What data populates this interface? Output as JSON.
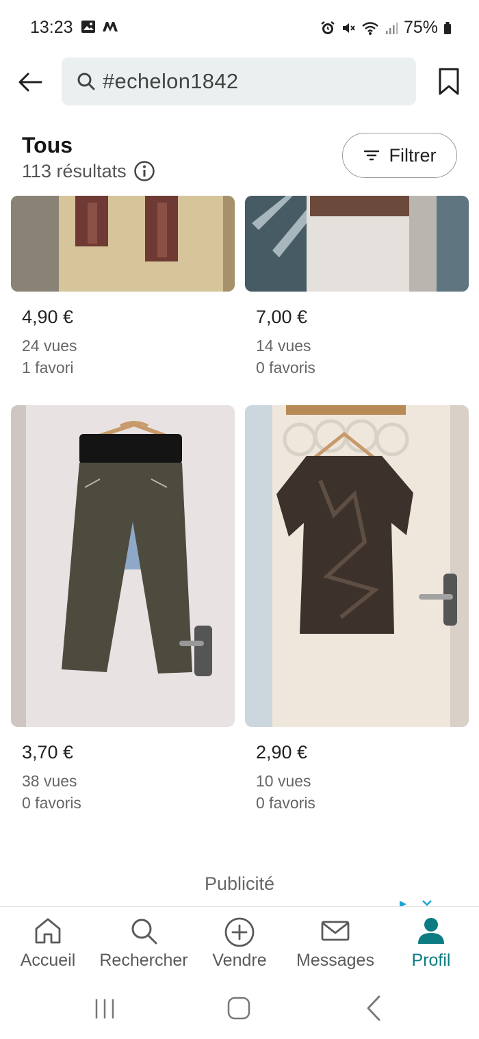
{
  "status_bar": {
    "time": "13:23",
    "battery": "75%"
  },
  "search": {
    "value": "#echelon1842"
  },
  "results": {
    "title": "Tous",
    "count": "113 résultats",
    "filter_label": "Filtrer"
  },
  "items": [
    {
      "price": "4,90 €",
      "views": "24 vues",
      "favorites": "1 favori"
    },
    {
      "price": "7,00 €",
      "views": "14 vues",
      "favorites": "0 favoris"
    },
    {
      "price": "3,70 €",
      "views": "38 vues",
      "favorites": "0 favoris"
    },
    {
      "price": "2,90 €",
      "views": "10 vues",
      "favorites": "0 favoris"
    }
  ],
  "ad_label": "Publicité",
  "bottom_nav": [
    {
      "label": "Accueil",
      "icon": "home-icon"
    },
    {
      "label": "Rechercher",
      "icon": "search-icon"
    },
    {
      "label": "Vendre",
      "icon": "plus-circle-icon"
    },
    {
      "label": "Messages",
      "icon": "mail-icon"
    },
    {
      "label": "Profil",
      "icon": "profile-icon",
      "active": true
    }
  ],
  "colors": {
    "accent": "#0d7c82",
    "search_bg": "#e9f0ef"
  }
}
